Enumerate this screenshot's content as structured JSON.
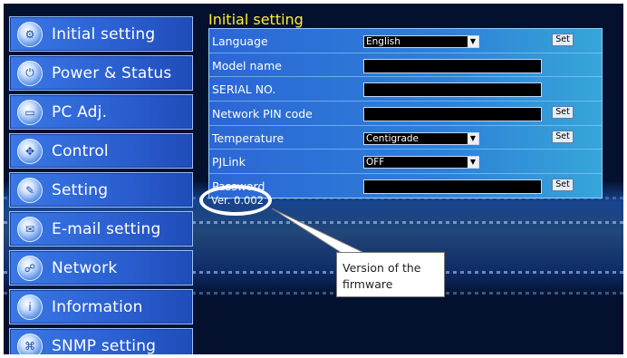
{
  "section": {
    "title": "Initial setting"
  },
  "sidebar": {
    "items": [
      {
        "label": "Initial setting",
        "icon": "gear-icon"
      },
      {
        "label": "Power & Status",
        "icon": "power-icon"
      },
      {
        "label": "PC Adj.",
        "icon": "monitor-icon"
      },
      {
        "label": "Control",
        "icon": "control-icon"
      },
      {
        "label": "Setting",
        "icon": "wrench-icon"
      },
      {
        "label": "E-mail setting",
        "icon": "mail-icon"
      },
      {
        "label": "Network",
        "icon": "network-icon"
      },
      {
        "label": "Information",
        "icon": "info-icon"
      },
      {
        "label": "SNMP setting",
        "icon": "snmp-icon"
      }
    ]
  },
  "settings": {
    "language": {
      "label": "Language",
      "value": "English",
      "button": "Set"
    },
    "model_name": {
      "label": "Model name",
      "value": ""
    },
    "serial_no": {
      "label": "SERIAL NO.",
      "value": ""
    },
    "network_pin": {
      "label": "Network PIN code",
      "value": "",
      "button": "Set"
    },
    "temperature": {
      "label": "Temperature",
      "value": "Centigrade",
      "button": "Set"
    },
    "pjlink": {
      "label": "PJLink",
      "value": "OFF"
    },
    "password": {
      "label": "Password",
      "value": "",
      "button": "Set"
    }
  },
  "version": {
    "text": "Ver. 0.002"
  },
  "callout": {
    "text": "Version of the firmware"
  },
  "colors": {
    "title": "#ffee33",
    "panel": "#2e80d8",
    "background": "#03102e"
  }
}
